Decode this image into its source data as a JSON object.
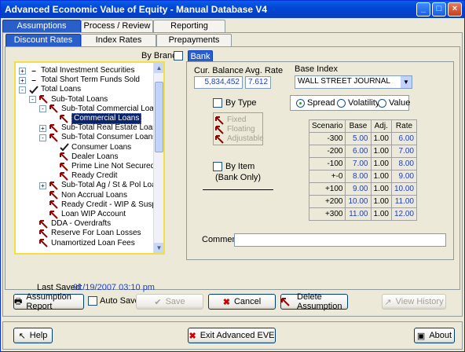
{
  "window": {
    "title": "Advanced Economic Value of Equity - Manual Database V4"
  },
  "tabs_main": [
    "Assumptions",
    "Process / Review",
    "Reporting"
  ],
  "tabs_sub": [
    "Discount Rates",
    "Index Rates",
    "Prepayments"
  ],
  "by_branch_label": "By Branch",
  "bank_tab": "Bank",
  "tree": [
    {
      "label": "Total Investment Securities",
      "indent": 0,
      "expander": "+",
      "icon": "dash"
    },
    {
      "label": "Total Short Term Funds Sold",
      "indent": 0,
      "expander": "+",
      "icon": "dash"
    },
    {
      "label": "Total Loans",
      "indent": 0,
      "expander": "-",
      "icon": "check"
    },
    {
      "label": "Sub-Total Loans",
      "indent": 1,
      "expander": "-",
      "icon": "arrow"
    },
    {
      "label": "Sub-Total Commercial Loans",
      "indent": 2,
      "expander": "-",
      "icon": "arrow"
    },
    {
      "label": "Commercial Loans",
      "indent": 3,
      "expander": "",
      "icon": "arrow",
      "selected": true
    },
    {
      "label": "Sub-Total Real Estate Loans",
      "indent": 2,
      "expander": "+",
      "icon": "arrow"
    },
    {
      "label": "Sub-Total Consumer Loans",
      "indent": 2,
      "expander": "-",
      "icon": "arrow"
    },
    {
      "label": "Consumer Loans",
      "indent": 3,
      "expander": "",
      "icon": "check"
    },
    {
      "label": "Dealer Loans",
      "indent": 3,
      "expander": "",
      "icon": "arrow"
    },
    {
      "label": "Prime Line Not Secured I",
      "indent": 3,
      "expander": "",
      "icon": "arrow"
    },
    {
      "label": "Ready Credit",
      "indent": 3,
      "expander": "",
      "icon": "arrow"
    },
    {
      "label": "Sub-Total Ag / St & Pol Loar",
      "indent": 2,
      "expander": "+",
      "icon": "arrow"
    },
    {
      "label": "Non Accrual Loans",
      "indent": 2,
      "expander": "",
      "icon": "arrow"
    },
    {
      "label": "Ready Credit - WIP & Suspen",
      "indent": 2,
      "expander": "",
      "icon": "arrow"
    },
    {
      "label": "Loan WIP Account",
      "indent": 2,
      "expander": "",
      "icon": "arrow"
    },
    {
      "label": "DDA - Overdrafts",
      "indent": 1,
      "expander": "",
      "icon": "arrow"
    },
    {
      "label": "Reserve For Loan Losses",
      "indent": 1,
      "expander": "",
      "icon": "arrow"
    },
    {
      "label": "Unamortized Loan Fees",
      "indent": 1,
      "expander": "",
      "icon": "arrow"
    }
  ],
  "cur_balance_label": "Cur. Balance",
  "cur_balance": "5,834,452",
  "avg_rate_label": "Avg. Rate",
  "avg_rate": "7.612",
  "base_index_label": "Base Index",
  "base_index": "WALL STREET JOURNAL",
  "by_type_label": "By Type",
  "types": [
    "Fixed",
    "Floating",
    "Adjustable"
  ],
  "modes": [
    "Spread",
    "Volatility",
    "Value"
  ],
  "by_item_label": "By Item",
  "bank_only_label": "(Bank Only)",
  "grid": {
    "headers": [
      "Scenario",
      "Base",
      "Adj.",
      "Rate"
    ],
    "rows": [
      [
        "-300",
        "5.00",
        "1.00",
        "6.00"
      ],
      [
        "-200",
        "6.00",
        "1.00",
        "7.00"
      ],
      [
        "-100",
        "7.00",
        "1.00",
        "8.00"
      ],
      [
        "+-0",
        "8.00",
        "1.00",
        "9.00"
      ],
      [
        "+100",
        "9.00",
        "1.00",
        "10.00"
      ],
      [
        "+200",
        "10.00",
        "1.00",
        "11.00"
      ],
      [
        "+300",
        "11.00",
        "1.00",
        "12.00"
      ]
    ]
  },
  "comment_label": "Comment:",
  "last_saved_label": "Last Saved:",
  "last_saved": "01/19/2007 03:10 pm",
  "buttons": {
    "assumption_report": "Assumption Report",
    "auto_save": "Auto Save",
    "save": "Save",
    "cancel": "Cancel",
    "delete": "Delete Assumption",
    "view_history": "View History",
    "help": "Help",
    "exit": "Exit Advanced EVE",
    "about": "About"
  }
}
